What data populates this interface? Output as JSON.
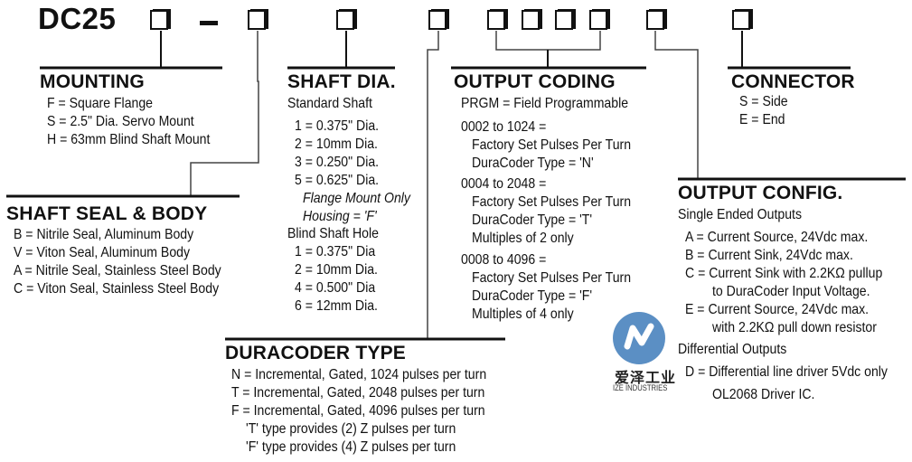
{
  "model": "DC25",
  "separator": "–",
  "sections": {
    "mounting": {
      "title": "MOUNTING",
      "items": [
        "F = Square Flange",
        "S = 2.5\" Dia. Servo Mount",
        "H = 63mm Blind Shaft Mount"
      ]
    },
    "shaft_seal_body": {
      "title": "SHAFT SEAL & BODY",
      "items": [
        "B = Nitrile Seal, Aluminum Body",
        "V = Viton Seal, Aluminum Body",
        "A = Nitrile Seal, Stainless Steel Body",
        "C = Viton Seal, Stainless Steel Body"
      ]
    },
    "shaft_dia": {
      "title": "SHAFT DIA.",
      "standard_label": "Standard Shaft",
      "standard_items": [
        "1 = 0.375\" Dia.",
        "2 = 10mm Dia.",
        "3 = 0.250\" Dia.",
        "5 = 0.625\" Dia."
      ],
      "note_1": "Flange Mount Only",
      "note_2": "Housing = 'F'",
      "blind_label": "Blind Shaft Hole",
      "blind_items": [
        "1 = 0.375\" Dia",
        "2 = 10mm Dia.",
        "4 = 0.500\" Dia",
        "6 = 12mm Dia."
      ]
    },
    "output_coding": {
      "title": "OUTPUT CODING",
      "prgm": "PRGM = Field Programmable",
      "groups": [
        {
          "range": "0002 to 1024 =",
          "lines": [
            "Factory Set Pulses Per Turn",
            "DuraCoder Type = 'N'"
          ]
        },
        {
          "range": "0004 to 2048 =",
          "lines": [
            "Factory Set Pulses Per Turn",
            "DuraCoder Type = 'T'",
            "Multiples of 2 only"
          ]
        },
        {
          "range": "0008 to 4096 =",
          "lines": [
            "Factory Set Pulses Per Turn",
            "DuraCoder Type = 'F'",
            "Multiples of 4 only"
          ]
        }
      ]
    },
    "connector": {
      "title": "CONNECTOR",
      "items": [
        "S = Side",
        "E = End"
      ]
    },
    "output_config": {
      "title": "OUTPUT CONFIG.",
      "single_label": "Single Ended Outputs",
      "single_items": [
        "A = Current Source, 24Vdc max.",
        "B = Current Sink, 24Vdc max.",
        "C = Current Sink with 2.2KΩ pullup",
        "to DuraCoder Input Voltage.",
        "E = Current Source, 24Vdc max.",
        "with 2.2KΩ pull down resistor"
      ],
      "diff_label": "Differential Outputs",
      "diff_items": [
        "D = Differential line driver 5Vdc only",
        "OL2068 Driver IC."
      ]
    },
    "duracoder_type": {
      "title": "DURACODER TYPE",
      "items": [
        "N = Incremental, Gated, 1024 pulses per turn",
        "T = Incremental, Gated, 2048 pulses per turn",
        "F = Incremental, Gated, 4096 pulses per turn",
        "'T' type provides (2) Z pulses per turn",
        "'F' type provides (4) Z pulses per turn"
      ]
    }
  },
  "watermark": {
    "name_cn": "爱泽工业",
    "name_en": "IZE INDUSTRIES",
    "color": "#5b8fc4"
  }
}
